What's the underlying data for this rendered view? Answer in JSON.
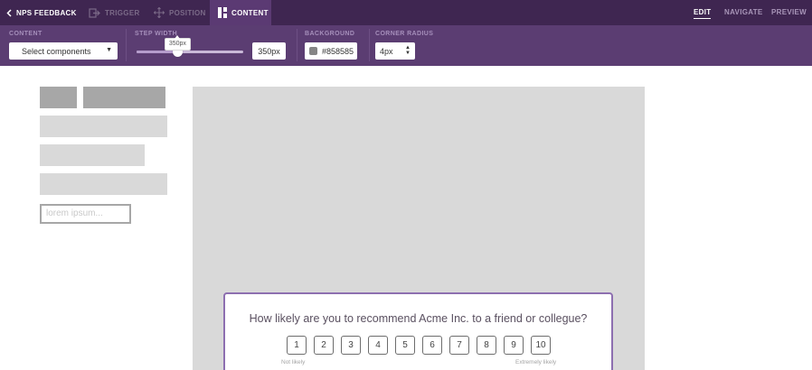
{
  "topbar": {
    "back_label": "NPS FEEDBACK",
    "tabs": [
      {
        "label": "TRIGGER",
        "icon": "exit-arrow-icon",
        "active": false
      },
      {
        "label": "POSITION",
        "icon": "move-arrows-icon",
        "active": false
      },
      {
        "label": "CONTENT",
        "icon": "layout-blocks-icon",
        "active": true
      }
    ],
    "modes": [
      {
        "label": "EDIT",
        "active": true
      },
      {
        "label": "NAVIGATE",
        "active": false
      },
      {
        "label": "PREVIEW",
        "active": false
      }
    ]
  },
  "toolbar": {
    "content": {
      "label": "CONTENT",
      "value": "Select components"
    },
    "step_width": {
      "label": "STEP WIDTH",
      "value": "350px",
      "tooltip": "350px",
      "level_percent": 38
    },
    "background": {
      "label": "BACKGROUND",
      "value": "#858585",
      "swatch_color": "#858585"
    },
    "corner_radius": {
      "label": "CORNER RADIUS",
      "value": "4px"
    }
  },
  "components": {
    "input_placeholder": "lorem ipsum..."
  },
  "survey": {
    "question": "How likely are you to recommend Acme Inc. to a friend or collegue?",
    "scores": [
      "1",
      "2",
      "3",
      "4",
      "5",
      "6",
      "7",
      "8",
      "9",
      "10"
    ],
    "low_label": "Not likely",
    "high_label": "Extremely likely",
    "border_color": "#8d6fb0"
  },
  "colors": {
    "topbar": "#3f2651",
    "toolbar": "#5b3d72",
    "canvas": "#d9d9d9"
  }
}
